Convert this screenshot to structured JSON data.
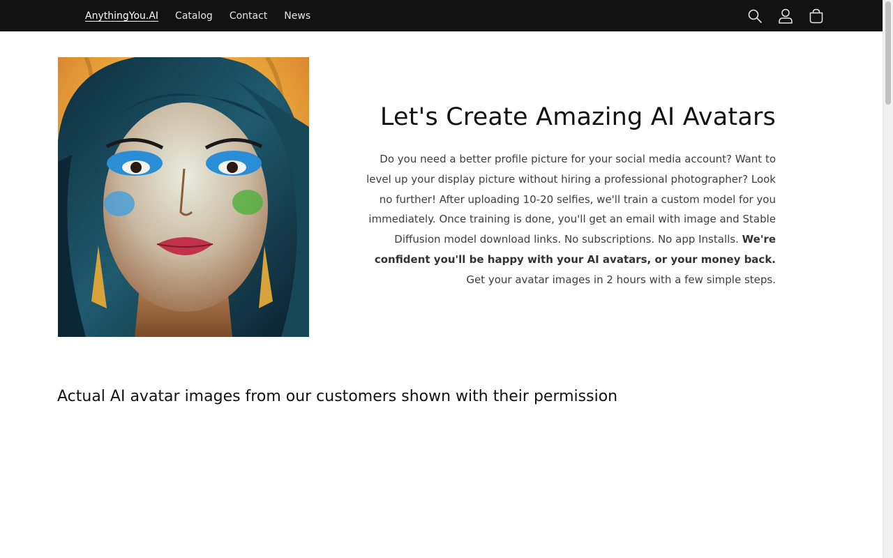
{
  "header": {
    "brand": "AnythingYou.AI",
    "nav": [
      {
        "label": "Catalog"
      },
      {
        "label": "Contact"
      },
      {
        "label": "News"
      }
    ],
    "icons": [
      "search-icon",
      "account-icon",
      "cart-icon"
    ],
    "background": "#121212"
  },
  "hero": {
    "title": "Let's Create Amazing AI Avatars",
    "body_start": "Do you need a better profile picture for your social media account? Want to level up your display picture without hiring a professional photographer? Look no further! After uploading 10-20 selfies, we'll train a custom model for you immediately. Once training is done, you'll get an email with image and Stable Diffusion model download links. No subscriptions. No app Installs. ",
    "body_bold": "We're confident you'll be happy with your AI avatars, or your money back.",
    "body_end": " Get your avatar images in 2 hours with a few simple steps."
  },
  "gallery": {
    "title": "Actual AI avatar images from our customers shown with their permission"
  }
}
